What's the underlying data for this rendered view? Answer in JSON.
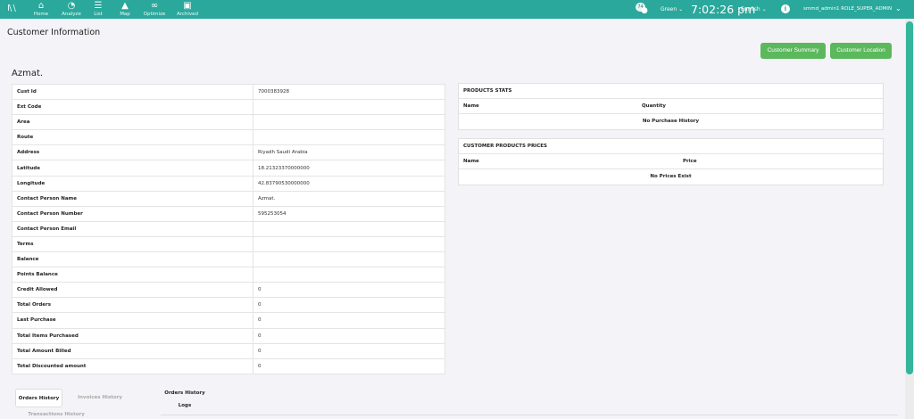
{
  "nav": {
    "logo": "I\\ \\",
    "items": [
      {
        "label": "Home",
        "icon": "home-icon"
      },
      {
        "label": "Analyze",
        "icon": "pie-chart-icon"
      },
      {
        "label": "List",
        "icon": "list-icon"
      },
      {
        "label": "Map",
        "icon": "map-icon"
      },
      {
        "label": "Optimize",
        "icon": "optimize-icon"
      },
      {
        "label": "Archived",
        "icon": "archive-icon"
      }
    ],
    "notification_badge": "74",
    "theme": "Green",
    "clock": "7:02:26 pm",
    "language": "English",
    "user": "smmd_admin1 ROLE_SUPER_ADMIN"
  },
  "page": {
    "title": "Customer Information",
    "summary_button": "Customer Summary",
    "location_button": "Customer Location",
    "customer_name": "Azmat."
  },
  "details": [
    {
      "key": "Cust Id",
      "value": "7000383928"
    },
    {
      "key": "Ext Code",
      "value": ""
    },
    {
      "key": "Area",
      "value": ""
    },
    {
      "key": "Route",
      "value": ""
    },
    {
      "key": "Address",
      "value": "Riyadh Saudi Arabia"
    },
    {
      "key": "Latitude",
      "value": "18.21323370000000"
    },
    {
      "key": "Longitude",
      "value": "42.83790530000000"
    },
    {
      "key": "Contact Person Name",
      "value": "Azmat."
    },
    {
      "key": "Contact Person Number",
      "value": "595253054"
    },
    {
      "key": "Contact Person Email",
      "value": ""
    },
    {
      "key": "Terms",
      "value": ""
    },
    {
      "key": "Balance",
      "value": ""
    },
    {
      "key": "Points Balance",
      "value": ""
    },
    {
      "key": "Credit Allowed",
      "value": "0"
    },
    {
      "key": "Total Orders",
      "value": "0"
    },
    {
      "key": "Last Purchase",
      "value": "0"
    },
    {
      "key": "Total Items Purchased",
      "value": "0"
    },
    {
      "key": "Total Amount Billed",
      "value": "0"
    },
    {
      "key": "Total Discounted amount",
      "value": "0"
    }
  ],
  "products_stats": {
    "title": "PRODUCTS STATS",
    "col_name": "Name",
    "col_quantity": "Quantity",
    "empty": "No Purchase History"
  },
  "customer_prices": {
    "title": "CUSTOMER PRODUCTS PRICES",
    "col_name": "Name",
    "col_price": "Price",
    "empty": "No Prices Exist"
  },
  "tabs": {
    "orders": "Orders History",
    "invoices": "Invoices History",
    "logs": "Orders History Logs",
    "transactions": "Transactions History"
  },
  "colors": {
    "topbar": "#2aa89c",
    "button": "#5bb85c",
    "scroll": "#35b59b"
  }
}
